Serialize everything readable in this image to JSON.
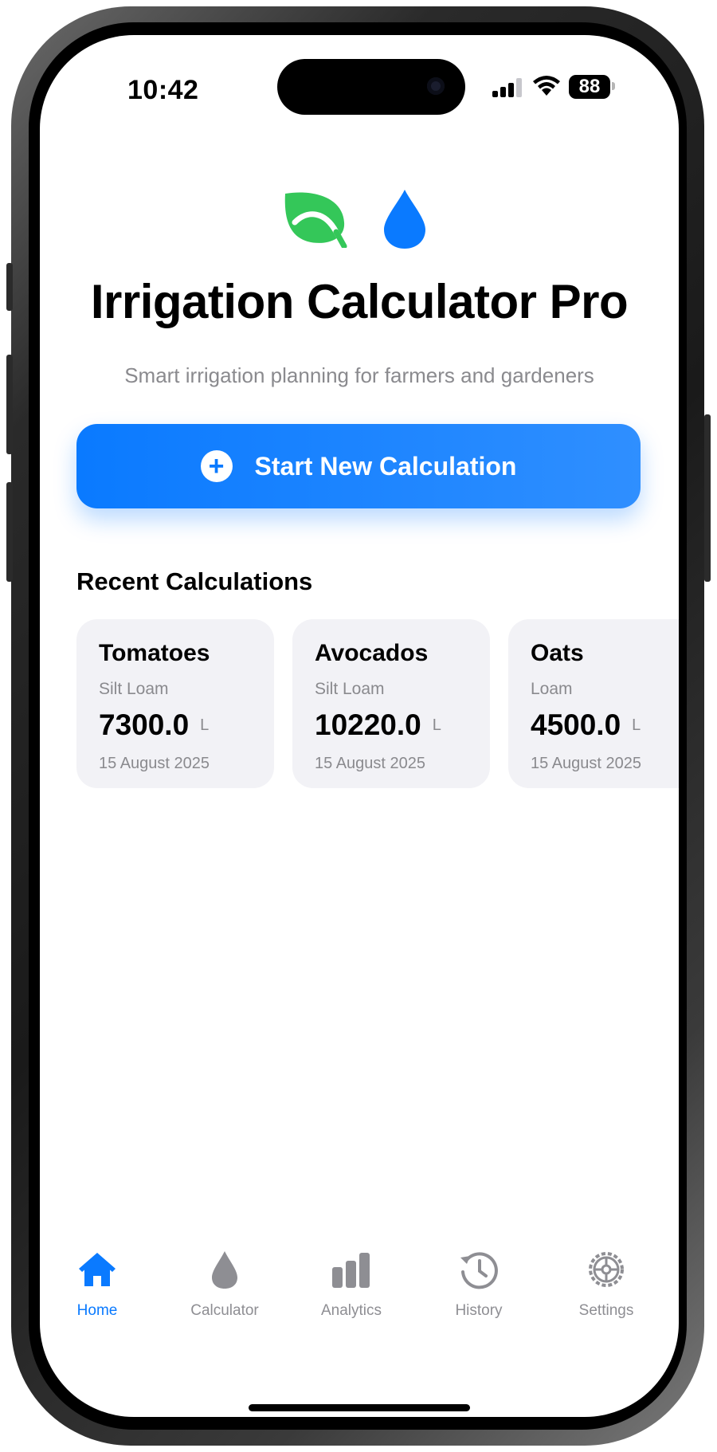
{
  "status_bar": {
    "time": "10:42",
    "battery": "88"
  },
  "app": {
    "title": "Irrigation Calculator Pro",
    "subtitle": "Smart irrigation planning for farmers and gardeners",
    "hero_icons": [
      "leaf-icon",
      "water-drop-icon"
    ]
  },
  "cta": {
    "label": "Start New Calculation",
    "icon": "plus-circle-icon"
  },
  "recent": {
    "title": "Recent Calculations",
    "cards": [
      {
        "crop": "Tomatoes",
        "soil": "Silt Loam",
        "value": "7300.0",
        "unit": "L",
        "date": "15 August 2025"
      },
      {
        "crop": "Avocados",
        "soil": "Silt Loam",
        "value": "10220.0",
        "unit": "L",
        "date": "15 August 2025"
      },
      {
        "crop": "Oats",
        "soil": "Loam",
        "value": "4500.0",
        "unit": "L",
        "date": "15 August 2025"
      }
    ]
  },
  "tabs": [
    {
      "label": "Home",
      "icon": "home-icon",
      "active": true
    },
    {
      "label": "Calculator",
      "icon": "drop-icon",
      "active": false
    },
    {
      "label": "Analytics",
      "icon": "bar-chart-icon",
      "active": false
    },
    {
      "label": "History",
      "icon": "clock-history-icon",
      "active": false
    },
    {
      "label": "Settings",
      "icon": "gear-icon",
      "active": false
    }
  ],
  "colors": {
    "accent": "#0A7AFF",
    "leaf": "#34C759",
    "card_bg": "#F2F2F6",
    "secondary_text": "#8A8A8E"
  }
}
